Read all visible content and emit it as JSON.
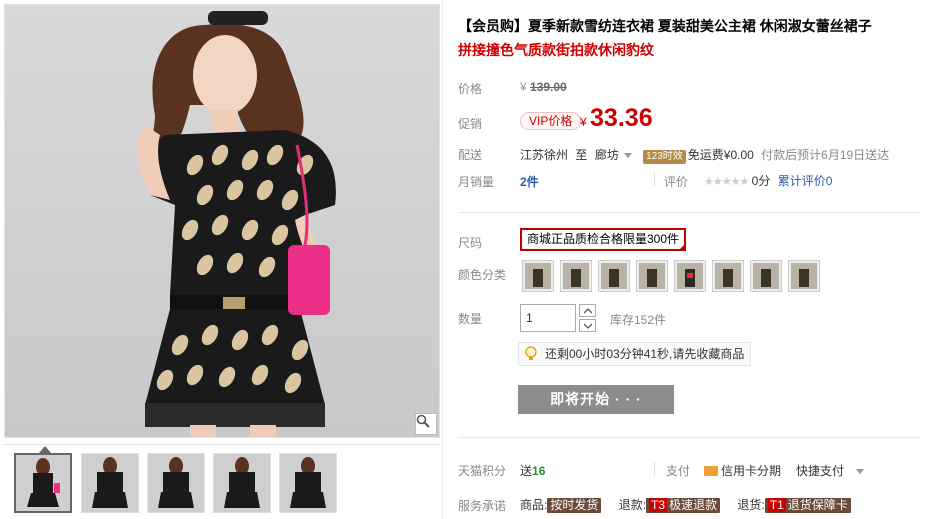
{
  "product": {
    "title_line1": "【会员购】夏季新款雪纺连衣裙 夏装甜美公主裙 休闲淑女蕾丝裙子",
    "title_line2": "拼接撞色气质款街拍款休闲豹纹"
  },
  "price": {
    "label": "价格",
    "currency": "¥",
    "original": "139.00"
  },
  "promo": {
    "label": "促销",
    "badge": "VIP价格",
    "currency": "¥",
    "value": "33.36"
  },
  "shipping": {
    "label": "配送",
    "from": "江苏徐州",
    "to_word": "至",
    "destination": "廊坊",
    "badge": "123时效",
    "fee_text": "免运费¥0.00",
    "eta": "付款后预计6月19日送达"
  },
  "sales": {
    "label": "月销量",
    "count": "2件",
    "rating_label": "评价",
    "stars": "★★★★★",
    "score": "0分",
    "review_link": "累计评价0"
  },
  "size": {
    "label": "尺码",
    "option": "商城正品质检合格限量300件"
  },
  "color": {
    "label": "颜色分类",
    "swatch_count": 8
  },
  "quantity": {
    "label": "数量",
    "value": "1",
    "stock": "库存152件"
  },
  "timer": {
    "text": "还剩00小时03分钟41秒,请先收藏商品"
  },
  "start_button": {
    "label": "即将开始 · · ·"
  },
  "points": {
    "label": "天猫积分",
    "prefix": "送",
    "value": "16",
    "pay_label": "支付",
    "card_pay": "信用卡分期",
    "quick_pay": "快捷支付"
  },
  "service": {
    "label": "服务承诺",
    "item1_prefix": "商品:",
    "item1_tag": "按时发货",
    "item2_prefix": "退款:",
    "item2_code": "T3",
    "item2_tag": "极速退款",
    "item3_prefix": "退货:",
    "item3_code": "T1",
    "item3_tag": "退货保障卡"
  },
  "colors": {
    "accent_red": "#cc0000",
    "button_gray": "#8c8c8c",
    "link_blue": "#2a5caa"
  }
}
